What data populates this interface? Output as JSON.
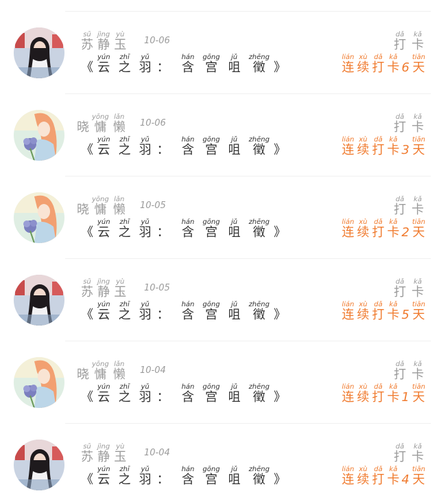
{
  "items": [
    {
      "avatar": "avatar-girl-photo",
      "name_type": "pinyin",
      "name": [
        {
          "py": "sū",
          "hz": "苏"
        },
        {
          "py": "jìng",
          "hz": "静"
        },
        {
          "py": "yù",
          "hz": "玉"
        }
      ],
      "date": "10-06",
      "days": "6"
    },
    {
      "avatar": "avatar-painting",
      "name_type": "mixed",
      "name_plain": "晓",
      "name": [
        {
          "py": "yōng",
          "hz": "慵"
        },
        {
          "py": "lǎn",
          "hz": "懒"
        }
      ],
      "date": "10-06",
      "days": "3"
    },
    {
      "avatar": "avatar-painting",
      "name_type": "mixed",
      "name_plain": "晓",
      "name": [
        {
          "py": "yōng",
          "hz": "慵"
        },
        {
          "py": "lǎn",
          "hz": "懒"
        }
      ],
      "date": "10-05",
      "days": "2"
    },
    {
      "avatar": "avatar-girl-photo",
      "name_type": "pinyin",
      "name": [
        {
          "py": "sū",
          "hz": "苏"
        },
        {
          "py": "jìng",
          "hz": "静"
        },
        {
          "py": "yù",
          "hz": "玉"
        }
      ],
      "date": "10-05",
      "days": "5"
    },
    {
      "avatar": "avatar-painting",
      "name_type": "mixed",
      "name_plain": "晓",
      "name": [
        {
          "py": "yōng",
          "hz": "慵"
        },
        {
          "py": "lǎn",
          "hz": "懒"
        }
      ],
      "date": "10-04",
      "days": "1"
    },
    {
      "avatar": "avatar-girl-photo",
      "name_type": "pinyin",
      "name": [
        {
          "py": "sū",
          "hz": "苏"
        },
        {
          "py": "jìng",
          "hz": "静"
        },
        {
          "py": "yù",
          "hz": "玉"
        }
      ],
      "date": "10-04",
      "days": "4"
    }
  ],
  "title": {
    "open": "《",
    "close": "》",
    "colon": "：",
    "part1": [
      {
        "py": "yún",
        "hz": "云"
      },
      {
        "py": "zhī",
        "hz": "之"
      },
      {
        "py": "yǔ",
        "hz": "羽"
      }
    ],
    "part2": [
      {
        "py": "hán",
        "hz": "含"
      },
      {
        "py": "gōng",
        "hz": "宫"
      },
      {
        "py": "jǔ",
        "hz": "咀"
      },
      {
        "py": "zhēng",
        "hz": "徵"
      }
    ]
  },
  "checkin_label": [
    {
      "py": "dǎ",
      "hz": "打"
    },
    {
      "py": "kǎ",
      "hz": "卡"
    }
  ],
  "streak_prefix": [
    {
      "py": "lián",
      "hz": "连"
    },
    {
      "py": "xù",
      "hz": "续"
    },
    {
      "py": "dǎ",
      "hz": "打"
    },
    {
      "py": "kǎ",
      "hz": "卡"
    }
  ],
  "streak_suffix": {
    "py": "tiān",
    "hz": "天"
  },
  "colors": {
    "accent": "#f07b2f",
    "muted": "#9b9b9b",
    "text": "#333333",
    "divider": "#f0f0f0"
  }
}
